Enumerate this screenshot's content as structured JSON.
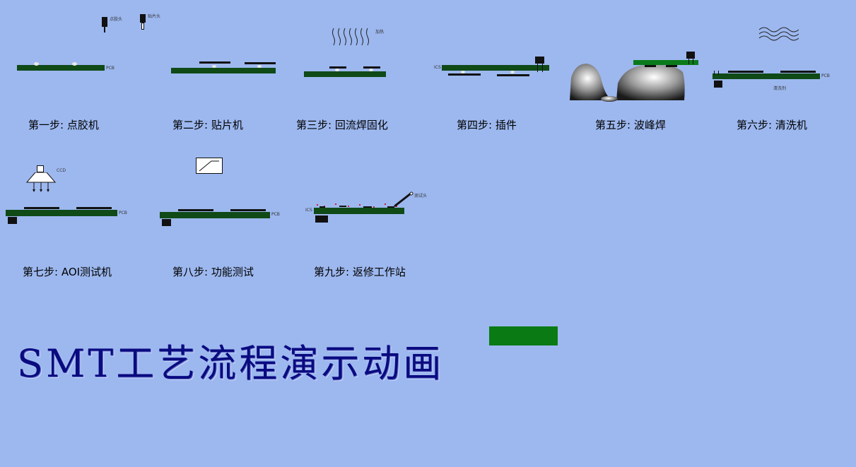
{
  "title": "SMT工艺流程演示动画",
  "steps": [
    {
      "label": "第一步: 点胶机",
      "tags": [
        "点胶头",
        "贴片头",
        "PCB"
      ]
    },
    {
      "label": "第二步: 贴片机"
    },
    {
      "label": "第三步: 回流焊固化",
      "tags": [
        "加热"
      ]
    },
    {
      "label": "第四步: 插件",
      "tags": [
        "ICS"
      ]
    },
    {
      "label": "第五步: 波峰焊"
    },
    {
      "label": "第六步: 清洗机",
      "tags": [
        "PCB",
        "清洗剂"
      ]
    },
    {
      "label": "第七步: AOI测试机",
      "tags": [
        "CCD",
        "PCB"
      ]
    },
    {
      "label": "第八步: 功能测试",
      "tags": [
        "PCB"
      ]
    },
    {
      "label": "第九步: 返修工作站",
      "tags": [
        "ICS",
        "测试头"
      ]
    }
  ],
  "colors": {
    "background": "#9db8ef",
    "pcb": "#0f4a17",
    "button": "#0a7a14",
    "title": "#0a0a80"
  }
}
